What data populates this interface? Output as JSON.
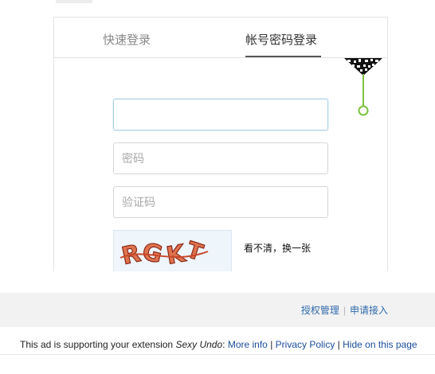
{
  "login": {
    "tabs": [
      {
        "label": "快速登录",
        "active": false
      },
      {
        "label": "帐号密码登录",
        "active": true
      }
    ],
    "account_input": {
      "value": "",
      "placeholder": ""
    },
    "password_input": {
      "value": "",
      "placeholder": "密码"
    },
    "captcha_input": {
      "value": "",
      "placeholder": "验证码"
    },
    "captcha": {
      "image_text": "RGKT",
      "refresh_label": "看不清，换一张"
    },
    "qr_toggle_icon": "qr-code-icon",
    "accent_color": "#7dc242"
  },
  "footer": {
    "links": [
      "授权管理",
      "申请接入"
    ],
    "separator": "|"
  },
  "ad": {
    "prefix": "This ad is supporting your extension ",
    "extension_name": "Sexy Undo",
    "colon": ": ",
    "links": [
      "More info",
      "Privacy Policy",
      "Hide on this page"
    ],
    "separator": " | "
  }
}
